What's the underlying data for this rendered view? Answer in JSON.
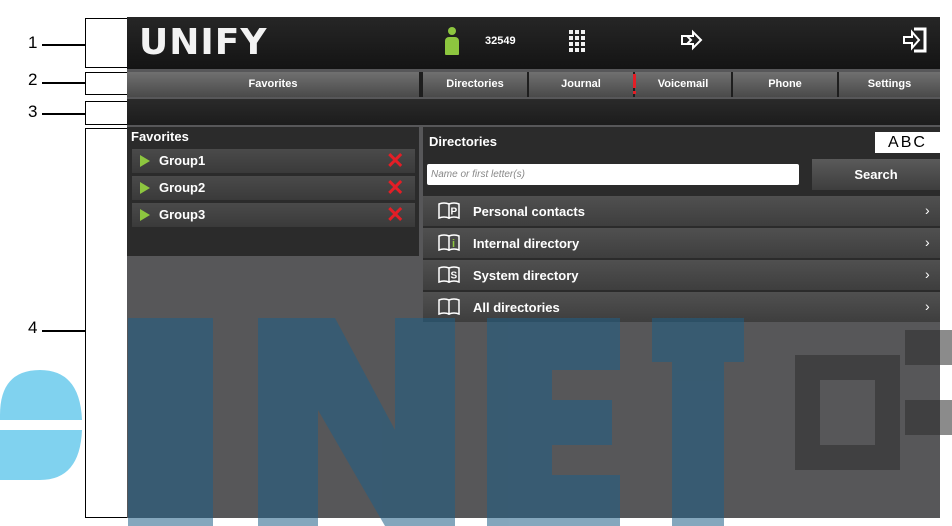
{
  "callouts": [
    "1",
    "2",
    "3",
    "4"
  ],
  "header": {
    "logo": "UNIFY",
    "extension": "32549"
  },
  "tabs": {
    "favorites": "Favorites",
    "directories": "Directories",
    "journal": "Journal",
    "voicemail": "Voicemail",
    "phone": "Phone",
    "settings": "Settings"
  },
  "favorites": {
    "title": "Favorites",
    "groups": [
      "Group1",
      "Group2",
      "Group3"
    ]
  },
  "directories": {
    "title": "Directories",
    "abc_label": "ABC",
    "search_placeholder": "Name or first letter(s)",
    "search_label": "Search",
    "items": [
      {
        "label": "Personal contacts",
        "letter": "P"
      },
      {
        "label": "Internal directory",
        "letter": "i"
      },
      {
        "label": "System directory",
        "letter": "S"
      },
      {
        "label": "All directories",
        "letter": ""
      }
    ]
  },
  "icons": [
    "user-icon",
    "keypad-icon",
    "transfer-icon",
    "logout-icon",
    "alert-icon",
    "play-icon",
    "delete-icon",
    "book-icon",
    "chevron-right-icon"
  ],
  "colors": {
    "accent_green": "#8dc63f",
    "alert_red": "#e41e26",
    "watermark_blue": "#1f7fc7",
    "watermark_light_blue": "#00a5e0"
  }
}
